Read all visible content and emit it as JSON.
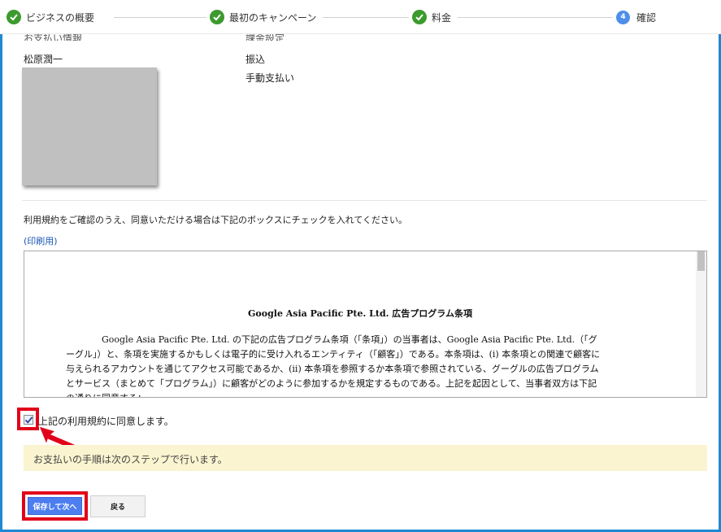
{
  "stepper": {
    "steps": [
      {
        "label": "ビジネスの概要",
        "state": "done"
      },
      {
        "label": "最初のキャンペーン",
        "state": "done"
      },
      {
        "label": "料金",
        "state": "done"
      },
      {
        "label": "確認",
        "state": "current",
        "number": "4"
      }
    ]
  },
  "summary": {
    "left_heading": "お支払い情報",
    "left_value": "松原潤一",
    "right_heading": "課金設定",
    "right_value_1": "振込",
    "right_value_2": "手動支払い"
  },
  "terms": {
    "instruction": "利用規約をご確認のうえ、同意いただける場合は下記のボックスにチェックを入れてください。",
    "print_link": "(印刷用)",
    "title": "Google Asia Pacific Pte. Ltd. 広告プログラム条項",
    "body": "Google Asia Pacific Pte. Ltd. の下記の広告プログラム条項（「条項」）の当事者は、Google Asia Pacific Pte. Ltd.（「グーグル」）と、条項を実施するかもしくは電子的に受け入れるエンティティ（「顧客」）である。本条項は、(i) 本条項との関連で顧客に与えられるアカウントを通じてアクセス可能であるか、(ii) 本条項を参照するか本条項で参照されている、グーグルの広告プログラムとサービス（まとめて「プログラム」）に顧客がどのように参加するかを規定するものである。上記を起因として、当事者双方は下記の通りに同意する："
  },
  "agreement": {
    "checkbox_label": "上記の利用規約に同意します。",
    "checked": true
  },
  "notice": "お支払いの手順は次のステップで行います。",
  "buttons": {
    "save_next": "保存して次へ",
    "back": "戻る"
  },
  "colors": {
    "accent_blue": "#4d7ef0",
    "step_done_green": "#3c9a2e",
    "highlight_red": "#e10019",
    "notice_bg": "#fbf4d0",
    "link_blue": "#1a56b4"
  }
}
